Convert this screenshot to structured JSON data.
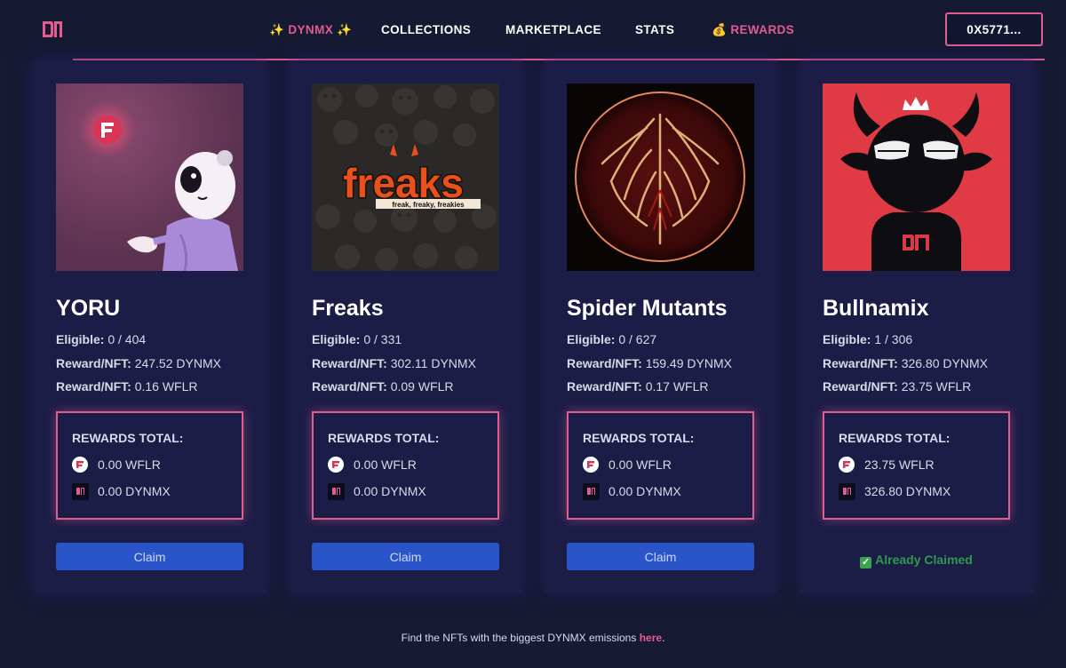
{
  "header": {
    "brand_label": "✨ DYNMX ✨",
    "nav": {
      "collections": "COLLECTIONS",
      "marketplace": "MARKETPLACE",
      "stats": "STATS",
      "rewards": "💰 REWARDS"
    },
    "wallet": "0X5771..."
  },
  "labels": {
    "eligible": "Eligible:",
    "reward_nft": "Reward/NFT:",
    "rewards_total": "REWARDS TOTAL:",
    "claim": "Claim",
    "already_claimed": "Already Claimed"
  },
  "cards": [
    {
      "title": "YORU",
      "eligible": "0 / 404",
      "reward_dynmx": "247.52 DYNMX",
      "reward_wflr": "0.16 WFLR",
      "total_wflr": "0.00 WFLR",
      "total_dynmx": "0.00 DYNMX"
    },
    {
      "title": "Freaks",
      "eligible": "0 / 331",
      "reward_dynmx": "302.11 DYNMX",
      "reward_wflr": "0.09 WFLR",
      "total_wflr": "0.00 WFLR",
      "total_dynmx": "0.00 DYNMX",
      "logo_text": "freaks",
      "logo_tagline": "freak, freaky, freakies"
    },
    {
      "title": "Spider Mutants",
      "eligible": "0 / 627",
      "reward_dynmx": "159.49 DYNMX",
      "reward_wflr": "0.17 WFLR",
      "total_wflr": "0.00 WFLR",
      "total_dynmx": "0.00 DYNMX"
    },
    {
      "title": "Bullnamix",
      "eligible": "1 / 306",
      "reward_dynmx": "326.80 DYNMX",
      "reward_wflr": "23.75 WFLR",
      "total_wflr": "23.75 WFLR",
      "total_dynmx": "326.80 DYNMX"
    }
  ],
  "footer": {
    "text": "Find the NFTs with the biggest DYNMX emissions ",
    "link": "here",
    "suffix": "."
  },
  "colors": {
    "background": "#161a33",
    "card": "#1b1d47",
    "accent_pink": "#e35d90",
    "claim_button": "#2a55c8",
    "claimed_green": "#2f9a4e"
  },
  "icons": [
    "dynmx-logo-icon",
    "flare-token-icon",
    "dynmx-token-icon",
    "check-icon"
  ]
}
